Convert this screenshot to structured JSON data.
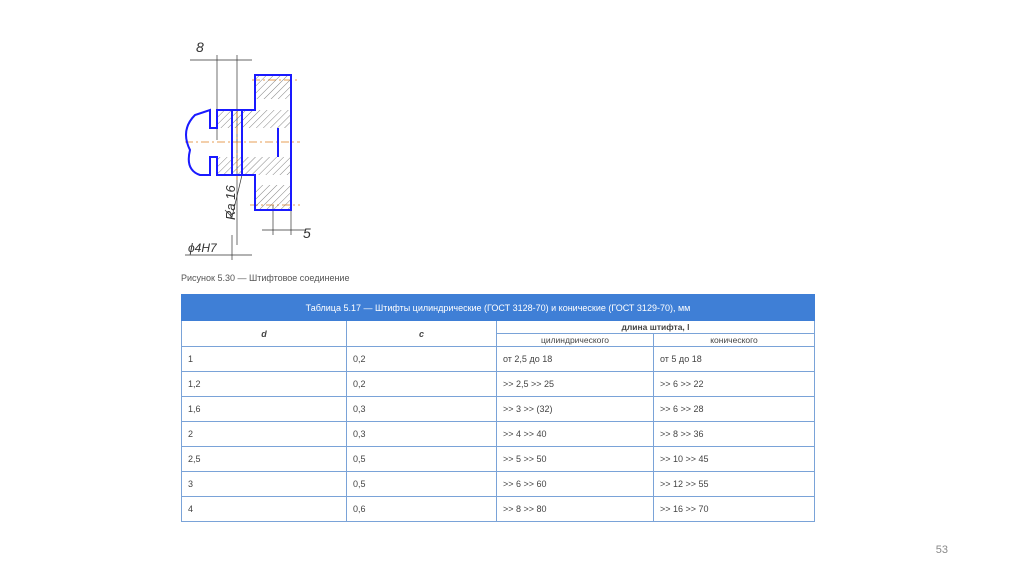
{
  "figure": {
    "dim_top": "8",
    "dim_right": "5",
    "roughness": "Ra 16",
    "fit": "ϕ4H7",
    "caption": "Рисунок 5.30 — Штифтовое соединение"
  },
  "table": {
    "title": "Таблица 5.17 — Штифты цилиндрические (ГОСТ 3128-70) и конические (ГОСТ 3129-70), мм",
    "headers": {
      "d": "d",
      "c": "c",
      "length": "длина штифта, l",
      "cyl": "цилиндрического",
      "con": "конического"
    },
    "rows": [
      [
        "1",
        "0,2",
        "от 2,5 до 18",
        "от 5 до 18"
      ],
      [
        "1,2",
        "0,2",
        ">> 2,5 >> 25",
        ">> 6  >> 22"
      ],
      [
        "1,6",
        "0,3",
        ">> 3 >> (32)",
        ">> 6 >> 28"
      ],
      [
        "2",
        "0,3",
        ">> 4 >> 40",
        ">> 8 >> 36"
      ],
      [
        "2,5",
        "0,5",
        ">> 5 >> 50",
        ">> 10 >> 45"
      ],
      [
        "3",
        "0,5",
        ">> 6 >> 60",
        ">> 12 >> 55"
      ],
      [
        "4",
        "0,6",
        ">> 8 >> 80",
        ">> 16 >> 70"
      ]
    ]
  },
  "page_number": "53"
}
